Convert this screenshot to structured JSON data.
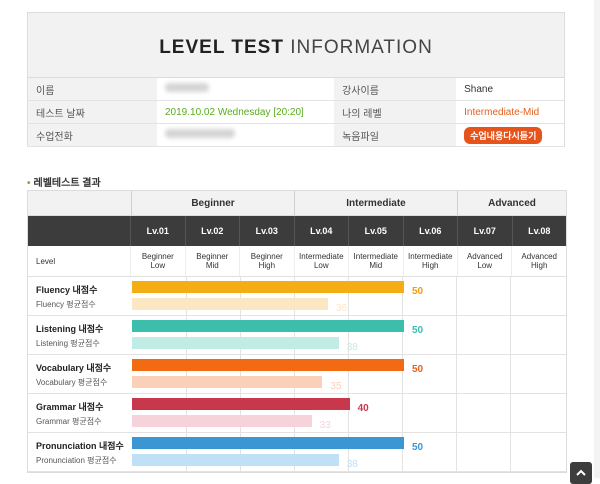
{
  "header": {
    "title_bold": "LEVEL TEST",
    "title_light": " INFORMATION"
  },
  "info": {
    "name_label": "이름",
    "teacher_label": "강사이름",
    "teacher_value": "Shane",
    "date_label": "테스트 날짜",
    "date_value": "2019.10.02  Wednesday [20:20]",
    "mylevel_label": "나의 레벨",
    "mylevel_value": "Intermediate-Mid",
    "phone_label": "수업전화",
    "record_label": "녹음파일",
    "record_button": "수업내용다시듣기"
  },
  "section_title": "레벨테스트 결과",
  "groups": [
    "Beginner",
    "Intermediate",
    "Advanced"
  ],
  "levels": [
    "Lv.01",
    "Lv.02",
    "Lv.03",
    "Lv.04",
    "Lv.05",
    "Lv.06",
    "Lv.07",
    "Lv.08"
  ],
  "level_label": "Level",
  "sublevels": [
    "Beginner\nLow",
    "Beginner\nMid",
    "Beginner\nHigh",
    "Intermediate\nLow",
    "Intermediate\nMid",
    "Intermediate\nHigh",
    "Advanced\nLow",
    "Advanced\nHigh"
  ],
  "metrics": [
    {
      "label": "Fluency 내점수",
      "avg_label": "Fluency 평균점수",
      "score": 50,
      "avg": 36,
      "color": "#f5ad14",
      "avg_color": "#fbe7c3",
      "score_color": "#f39c12"
    },
    {
      "label": "Listening 내점수",
      "avg_label": "Listening 평균점수",
      "score": 50,
      "avg": 38,
      "color": "#3dbdab",
      "avg_color": "#c1ece5",
      "score_color": "#3dbdab"
    },
    {
      "label": "Vocabulary 내점수",
      "avg_label": "Vocabulary 평균점수",
      "score": 50,
      "avg": 35,
      "color": "#f26a12",
      "avg_color": "#fbd0b8",
      "score_color": "#e8601c"
    },
    {
      "label": "Grammar 내점수",
      "avg_label": "Grammar 평균점수",
      "score": 40,
      "avg": 33,
      "color": "#c8384d",
      "avg_color": "#f6d3da",
      "score_color": "#c8384d"
    },
    {
      "label": "Pronunciation 내점수",
      "avg_label": "Pronunciation 평균점수",
      "score": 50,
      "avg": 38,
      "color": "#3a97d4",
      "avg_color": "#bfe0f5",
      "score_color": "#3a97d4"
    }
  ]
}
